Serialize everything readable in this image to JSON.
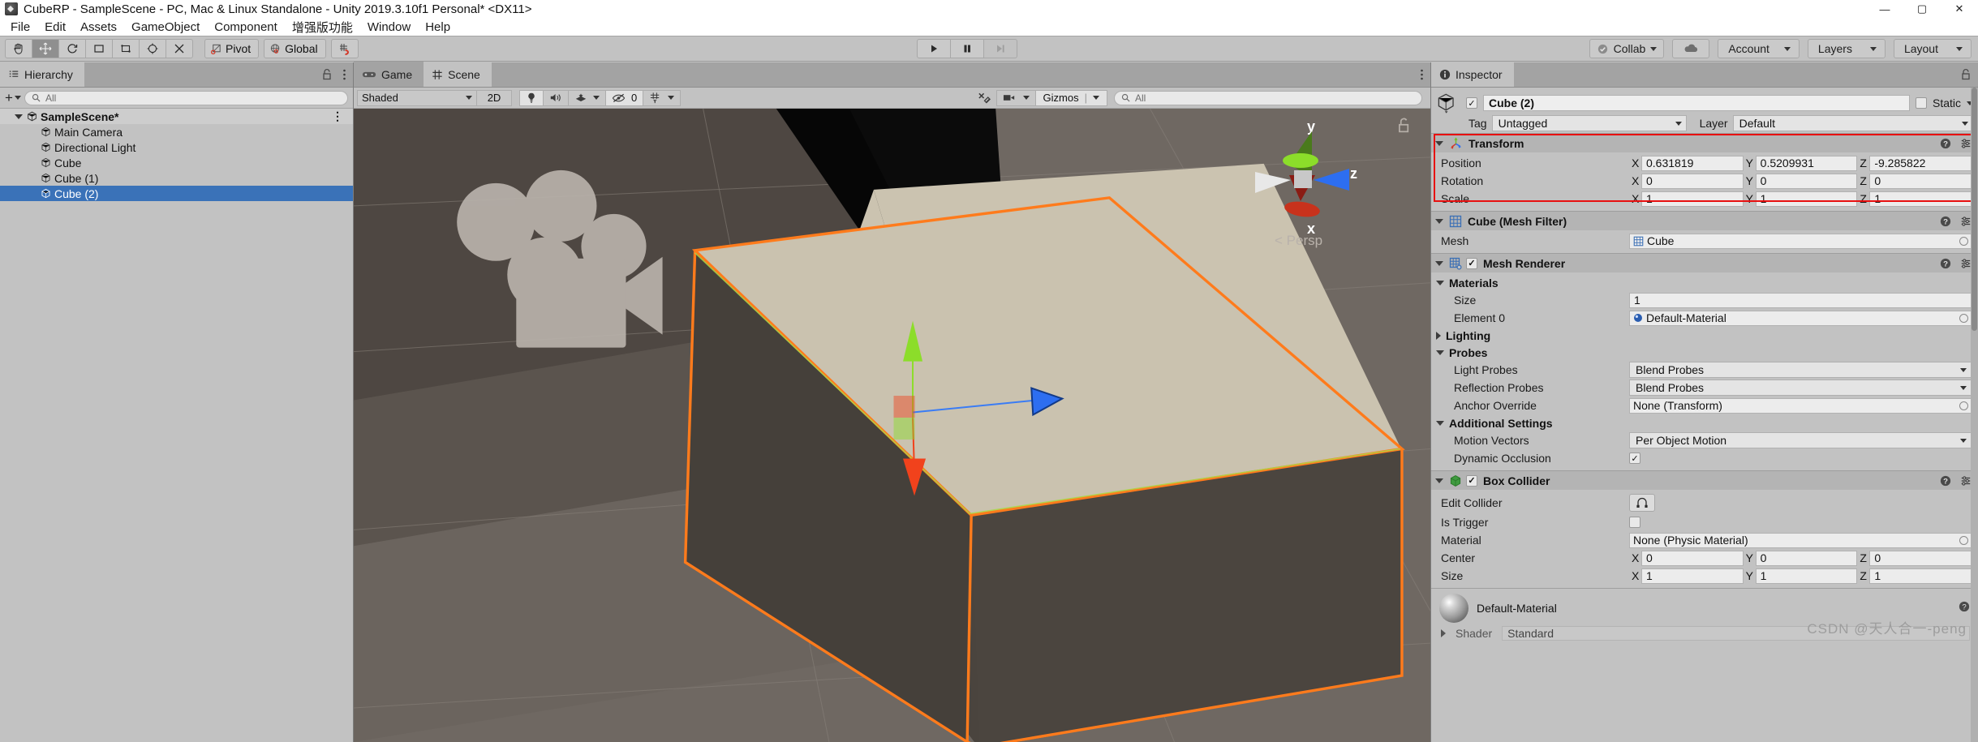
{
  "window": {
    "title": "CubeRP - SampleScene - PC, Mac & Linux Standalone - Unity 2019.3.10f1 Personal* <DX11>",
    "minimize": "—",
    "maximize": "▢",
    "close": "✕"
  },
  "menubar": {
    "items": [
      "File",
      "Edit",
      "Assets",
      "GameObject",
      "Component",
      "增强版功能",
      "Window",
      "Help"
    ]
  },
  "toolbar": {
    "transform_tools": [
      "hand-tool",
      "move-tool",
      "rotate-tool",
      "scale-tool",
      "rect-tool",
      "transform-tool",
      "custom-tool"
    ],
    "pivot_label": "Pivot",
    "global_label": "Global",
    "snap_label": "grid-snap",
    "play": "▶",
    "pause": "❚❚",
    "step": "▶❙",
    "collab_label": "Collab",
    "cloud_label": "cloud",
    "account_label": "Account",
    "layers_label": "Layers",
    "layout_label": "Layout"
  },
  "hierarchy": {
    "tab_label": "Hierarchy",
    "search_placeholder": "All",
    "add_label": "+",
    "rows": [
      {
        "label": "SampleScene*",
        "depth": 0,
        "type": "scene",
        "selected": false
      },
      {
        "label": "Main Camera",
        "depth": 1,
        "type": "object",
        "selected": false
      },
      {
        "label": "Directional Light",
        "depth": 1,
        "type": "object",
        "selected": false
      },
      {
        "label": "Cube",
        "depth": 1,
        "type": "object",
        "selected": false
      },
      {
        "label": "Cube (1)",
        "depth": 1,
        "type": "object",
        "selected": false
      },
      {
        "label": "Cube (2)",
        "depth": 1,
        "type": "object",
        "selected": true
      }
    ]
  },
  "scene": {
    "tabs": [
      {
        "label": "Game",
        "selected": false,
        "icon": "game-icon"
      },
      {
        "label": "Scene",
        "selected": true,
        "icon": "scene-grid-icon"
      }
    ],
    "draw_mode": "Shaded",
    "mode_2d": "2D",
    "lighting_icon": "lightbulb-icon",
    "audio_icon": "speaker-icon",
    "fx_icon": "effects-icon",
    "hidden_count": "0",
    "grid_icon": "grid-y-icon",
    "tools_icon": "scene-tools-icon",
    "camera_icon": "scene-camera-icon",
    "gizmos_label": "Gizmos",
    "gizmo_search_placeholder": "All",
    "axis_gizmo": {
      "y": "y",
      "x": "x",
      "z": "z",
      "persp": "Persp"
    }
  },
  "inspector": {
    "tab_label": "Inspector",
    "object": {
      "name": "Cube (2)",
      "enabled": true,
      "static_label": "Static",
      "tag_label": "Tag",
      "tag_value": "Untagged",
      "layer_label": "Layer",
      "layer_value": "Default"
    },
    "transform": {
      "title": "Transform",
      "rows": [
        {
          "label": "Position",
          "x": "0.631819",
          "y": "0.5209931",
          "z": "-9.285822"
        },
        {
          "label": "Rotation",
          "x": "0",
          "y": "0",
          "z": "0"
        },
        {
          "label": "Scale",
          "x": "1",
          "y": "1",
          "z": "1"
        }
      ],
      "highlight_color": "#e81010"
    },
    "mesh_filter": {
      "title": "Cube (Mesh Filter)",
      "mesh_label": "Mesh",
      "mesh_value": "Cube"
    },
    "mesh_renderer": {
      "title": "Mesh Renderer",
      "enabled": true,
      "materials_label": "Materials",
      "size_label": "Size",
      "size_value": "1",
      "element_label": "Element 0",
      "element_value": "Default-Material",
      "lighting_label": "Lighting",
      "probes_label": "Probes",
      "light_probes_label": "Light Probes",
      "light_probes_value": "Blend Probes",
      "reflection_probes_label": "Reflection Probes",
      "reflection_probes_value": "Blend Probes",
      "anchor_override_label": "Anchor Override",
      "anchor_override_value": "None (Transform)",
      "additional_settings_label": "Additional Settings",
      "motion_vectors_label": "Motion Vectors",
      "motion_vectors_value": "Per Object Motion",
      "dynamic_occlusion_label": "Dynamic Occlusion",
      "dynamic_occlusion_checked": true
    },
    "box_collider": {
      "title": "Box Collider",
      "enabled": true,
      "edit_collider_label": "Edit Collider",
      "is_trigger_label": "Is Trigger",
      "is_trigger_checked": false,
      "material_label": "Material",
      "material_value": "None (Physic Material)",
      "center_label": "Center",
      "center": {
        "x": "0",
        "y": "0",
        "z": "0"
      },
      "size_label": "Size",
      "size": {
        "x": "1",
        "y": "1",
        "z": "1"
      }
    },
    "material_preview": {
      "name": "Default-Material",
      "shader_label": "Shader",
      "shader_value": "Standard"
    }
  },
  "watermark": "CSDN @天人合一-peng",
  "colors": {
    "selection_blue": "#3a72b8",
    "panel_bg": "#c2c2c2",
    "header_bg": "#b4b4b4",
    "viewport_bg": "#6e6761",
    "outline_orange": "#ff7b1c",
    "axis_green": "#8cdd2a",
    "axis_red": "#f1421c",
    "axis_blue": "#2d6ef0"
  }
}
